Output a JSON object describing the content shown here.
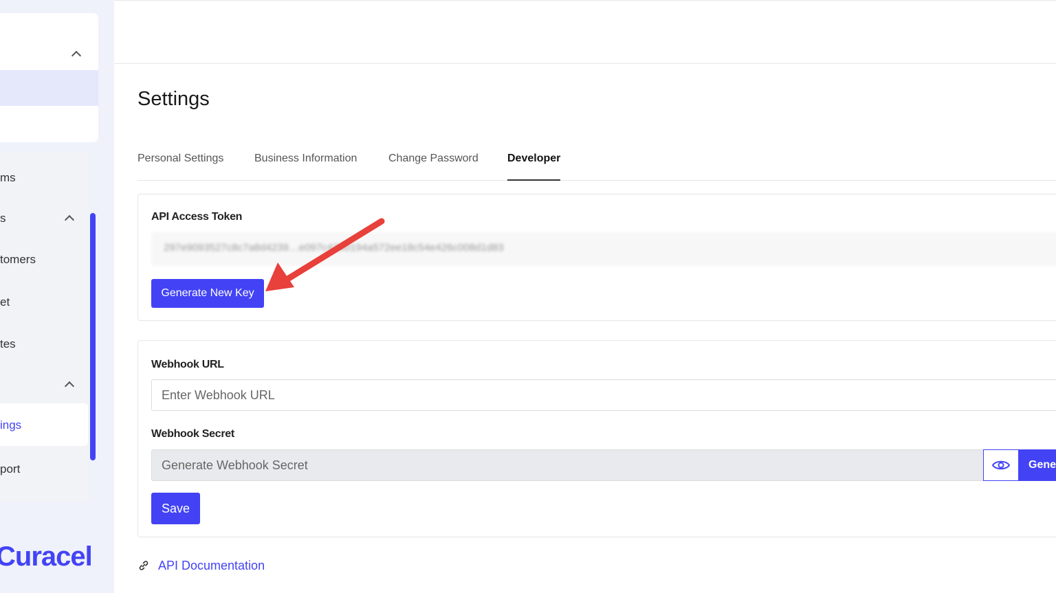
{
  "sidebar": {
    "items": [
      "ms",
      "s",
      "tomers",
      "et",
      "tes",
      "ings",
      "port"
    ],
    "logo": "Curacel"
  },
  "page": {
    "title": "Settings"
  },
  "tabs": [
    {
      "label": "Personal Settings"
    },
    {
      "label": "Business Information"
    },
    {
      "label": "Change Password"
    },
    {
      "label": "Developer",
      "active": true
    }
  ],
  "api": {
    "label": "API Access Token",
    "token": "297e9093527c8c7a8d4239…e097c4290194a572ee18c54e426c008d1d83",
    "generate_label": "Generate New Key"
  },
  "webhook": {
    "url_label": "Webhook URL",
    "url_placeholder": "Enter Webhook URL",
    "secret_label": "Webhook Secret",
    "secret_placeholder": "Generate Webhook Secret",
    "generate_label": "Generate",
    "save_label": "Save"
  },
  "doc_link": "API Documentation",
  "colors": {
    "accent": "#4343f5",
    "annotation_arrow": "#e8403a"
  }
}
